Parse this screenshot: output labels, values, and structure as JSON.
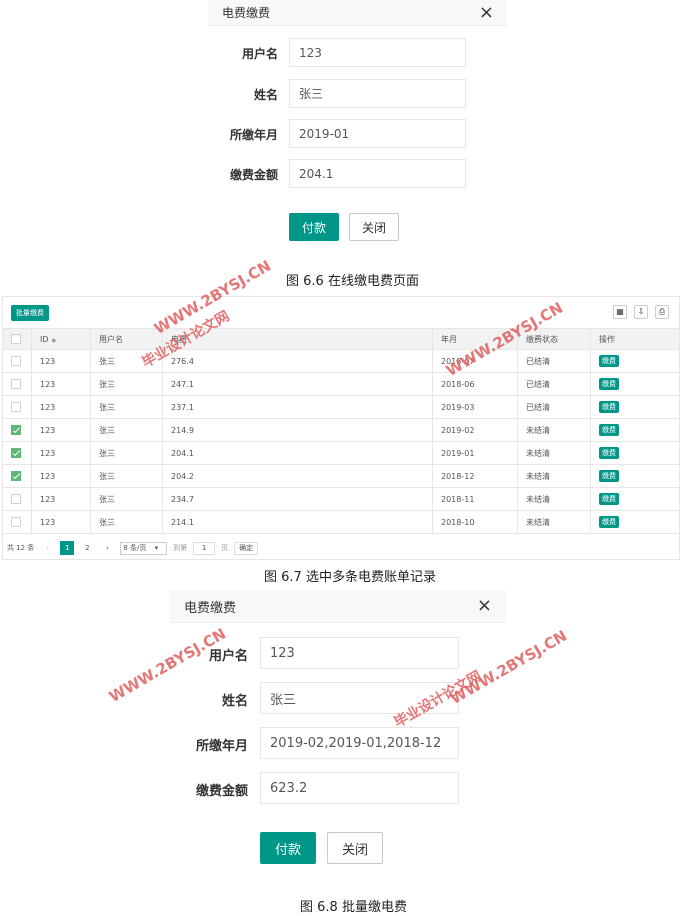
{
  "dialog1": {
    "title": "电费缴费",
    "username_label": "用户名",
    "username_value": "123",
    "name_label": "姓名",
    "name_value": "张三",
    "month_label": "所缴年月",
    "month_value": "2019-01",
    "amount_label": "缴费金额",
    "amount_value": "204.1",
    "pay_label": "付款",
    "close_label": "关闭"
  },
  "caption1": "图 6.6  在线缴电费页面",
  "table": {
    "batch_button": "批量缴费",
    "toolbar_icons": [
      "columns-icon",
      "export-icon",
      "print-icon"
    ],
    "headers": [
      "ID",
      "用户名",
      "电费",
      "年月",
      "缴费状态",
      "操作"
    ],
    "rows": [
      {
        "checked": false,
        "id": "123",
        "user": "张三",
        "fee": "276.4",
        "month": "2018-07",
        "status": "已结清",
        "action": "缴费"
      },
      {
        "checked": false,
        "id": "123",
        "user": "张三",
        "fee": "247.1",
        "month": "2018-06",
        "status": "已结清",
        "action": "缴费"
      },
      {
        "checked": false,
        "id": "123",
        "user": "张三",
        "fee": "237.1",
        "month": "2019-03",
        "status": "已结清",
        "action": "缴费"
      },
      {
        "checked": true,
        "id": "123",
        "user": "张三",
        "fee": "214.9",
        "month": "2019-02",
        "status": "未结清",
        "action": "缴费"
      },
      {
        "checked": true,
        "id": "123",
        "user": "张三",
        "fee": "204.1",
        "month": "2019-01",
        "status": "未结清",
        "action": "缴费"
      },
      {
        "checked": true,
        "id": "123",
        "user": "张三",
        "fee": "204.2",
        "month": "2018-12",
        "status": "未结清",
        "action": "缴费"
      },
      {
        "checked": false,
        "id": "123",
        "user": "张三",
        "fee": "234.7",
        "month": "2018-11",
        "status": "未结清",
        "action": "缴费"
      },
      {
        "checked": false,
        "id": "123",
        "user": "张三",
        "fee": "214.1",
        "month": "2018-10",
        "status": "未结清",
        "action": "缴费"
      }
    ],
    "pager": {
      "total": "共 12 条",
      "prev": "‹",
      "page1": "1",
      "page2": "2",
      "next": "›",
      "page_size": "8 条/页",
      "goto": "到第",
      "goto_value": "1",
      "page_unit": "页",
      "confirm": "确定"
    }
  },
  "caption2": "图 6.7 选中多条电费账单记录",
  "dialog2": {
    "title": "电费缴费",
    "username_label": "用户名",
    "username_value": "123",
    "name_label": "姓名",
    "name_value": "张三",
    "month_label": "所缴年月",
    "month_value": "2019-02,2019-01,2018-12",
    "amount_label": "缴费金额",
    "amount_value": "623.2",
    "pay_label": "付款",
    "close_label": "关闭"
  },
  "caption3": "图 6.8 批量缴电费",
  "watermark": {
    "url": "WWW.2BYSJ.CN",
    "site": "毕业设计论文网",
    "color": "#e06060"
  },
  "colors": {
    "primary": "#009688",
    "checked": "#5FB878"
  }
}
